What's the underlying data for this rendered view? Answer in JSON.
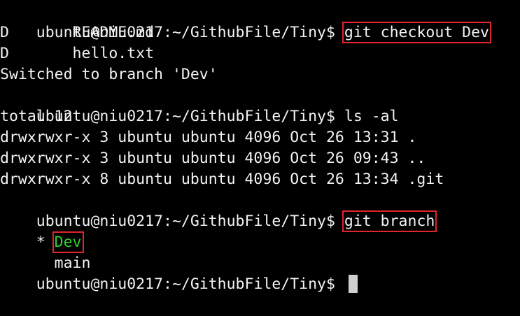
{
  "terminal": {
    "lines": [
      {
        "kind": "prompt",
        "prompt": "ubuntu@niu0217:~/GithubFile/Tiny$ ",
        "command": "git checkout Dev",
        "highlighted": true
      },
      {
        "kind": "output",
        "text": "D       README.md"
      },
      {
        "kind": "output",
        "text": "D       hello.txt"
      },
      {
        "kind": "output",
        "text": "Switched to branch 'Dev'"
      },
      {
        "kind": "prompt",
        "prompt": "ubuntu@niu0217:~/GithubFile/Tiny$ ",
        "command": "ls -al",
        "highlighted": false
      },
      {
        "kind": "output",
        "text": "total 12"
      },
      {
        "kind": "output",
        "text": "drwxrwxr-x 3 ubuntu ubuntu 4096 Oct 26 13:31 ."
      },
      {
        "kind": "output",
        "text": "drwxrwxr-x 3 ubuntu ubuntu 4096 Oct 26 09:43 .."
      },
      {
        "kind": "output",
        "text": "drwxrwxr-x 8 ubuntu ubuntu 4096 Oct 26 13:34 .git"
      },
      {
        "kind": "prompt",
        "prompt": "ubuntu@niu0217:~/GithubFile/Tiny$ ",
        "command": "git branch",
        "highlighted": true
      },
      {
        "kind": "branch",
        "marker": "* ",
        "name": "Dev",
        "current": true
      },
      {
        "kind": "branch",
        "marker": "  ",
        "name": "main",
        "current": false
      },
      {
        "kind": "prompt-active",
        "prompt": "ubuntu@niu0217:~/GithubFile/Tiny$ "
      }
    ],
    "colors": {
      "background": "#000000",
      "foreground": "#f2f2f2",
      "current_branch": "#2fd12f",
      "highlight_box": "#e0242c",
      "cursor": "#cfcfcf"
    }
  }
}
